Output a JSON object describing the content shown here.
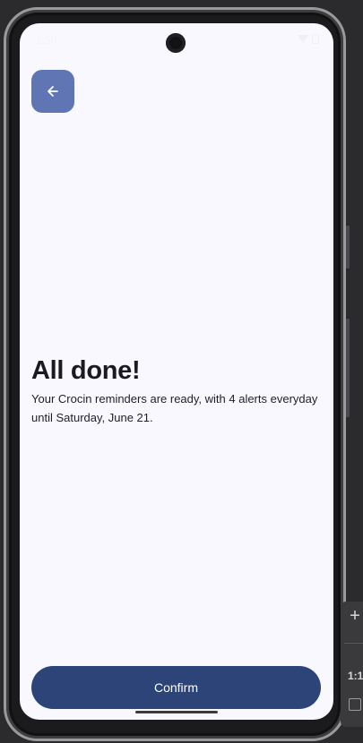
{
  "status_bar": {
    "time": "1:58",
    "icons": [
      "wifi-icon",
      "battery-icon"
    ]
  },
  "back_button": {
    "icon": "arrow-left-icon"
  },
  "screen": {
    "title": "All done!",
    "message": "Your Crocin reminders are ready, with 4 alerts everyday until Saturday, June 21."
  },
  "confirm_button": {
    "label": "Confirm"
  },
  "emulator_toolbar": {
    "add_icon": "plus-icon",
    "ratio_label": "1:1",
    "frame_icon": "device-frame-icon"
  },
  "colors": {
    "screen_background": "#f9f8ff",
    "back_button": "#5f75b4",
    "confirm_button": "#2c4478",
    "text": "#1a1b21"
  }
}
